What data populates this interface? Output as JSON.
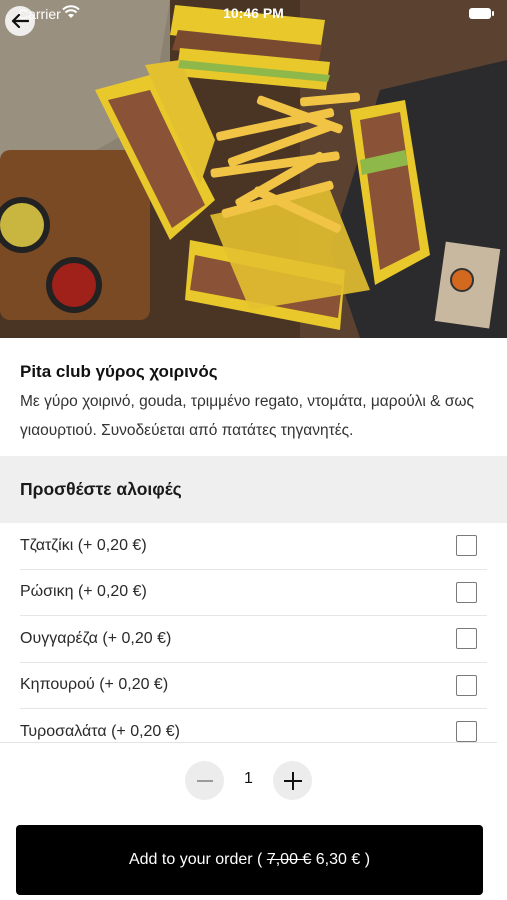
{
  "status_bar": {
    "carrier": "Carrier",
    "time": "10:46 PM"
  },
  "product": {
    "name": "Pita club γύρος χοιρινός",
    "description": "Με γύρο χοιρινό, gouda, τριμμένο regato, ντομάτα, μαρούλι & σως γιαουρτιού. Συνοδεύεται από πατάτες τηγανητές."
  },
  "extras": {
    "title": "Προσθέστε αλοιφές",
    "options": [
      {
        "label": "Τζατζίκι (+ 0,20 €)",
        "checked": false
      },
      {
        "label": "Ρώσικη (+ 0,20 €)",
        "checked": false
      },
      {
        "label": "Ουγγαρέζα (+ 0,20 €)",
        "checked": false
      },
      {
        "label": "Κηπουρού (+ 0,20 €)",
        "checked": false
      },
      {
        "label": "Τυροσαλάτα (+ 0,20 €)",
        "checked": false
      }
    ]
  },
  "quantity": {
    "value": "1",
    "minus": "−",
    "plus": "+"
  },
  "add_button": {
    "prefix": "Add to your order ( ",
    "old_price": "7,00 €",
    "new_price": " 6,30 € )"
  },
  "colors": {
    "button_bg": "#000000",
    "section_bg": "#efefef"
  }
}
